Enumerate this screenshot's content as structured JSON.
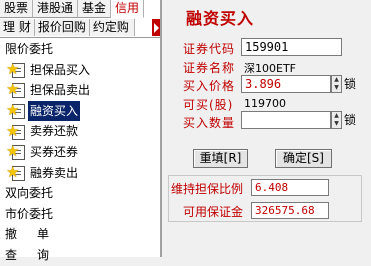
{
  "nav": {
    "top_tabs": [
      "股票",
      "港股通",
      "基金",
      "信用"
    ],
    "sub_tabs": [
      "理 财",
      "报价回购",
      "约定购"
    ],
    "menu": [
      {
        "label": "限价委托",
        "level": 0
      },
      {
        "label": "担保品买入",
        "level": 1,
        "icon": "star-doc-icon"
      },
      {
        "label": "担保品卖出",
        "level": 1,
        "icon": "star-doc-icon"
      },
      {
        "label": "融资买入",
        "level": 1,
        "icon": "star-doc-icon",
        "selected": true
      },
      {
        "label": "卖券还款",
        "level": 1,
        "icon": "star-doc-icon"
      },
      {
        "label": "买券还券",
        "level": 1,
        "icon": "star-doc-icon"
      },
      {
        "label": "融券卖出",
        "level": 1,
        "icon": "star-doc-icon"
      },
      {
        "label": "双向委托",
        "level": 0
      },
      {
        "label": "市价委托",
        "level": 0
      },
      {
        "label": "撤单",
        "level": 0
      },
      {
        "label": "查询",
        "level": 0
      }
    ]
  },
  "form": {
    "title": "融资买入",
    "code_label": "证券代码",
    "code_value": "159901",
    "name_label": "证券名称",
    "name_value": "深100ETF",
    "price_label": "买入价格",
    "price_value": "3.896",
    "buyable_label": "可买(股)",
    "buyable_value": "119700",
    "qty_label": "买入数量",
    "qty_value": "",
    "lock_label": "锁",
    "reset_button": "重填[R]",
    "confirm_button": "确定[S]"
  },
  "stats": {
    "ratio_label": "维持担保比例",
    "ratio_value": "6.408",
    "margin_label": "可用保证金",
    "margin_value": "326575.68"
  },
  "colors": {
    "accent_red": "#c00000",
    "selection_blue": "#0a246a"
  }
}
